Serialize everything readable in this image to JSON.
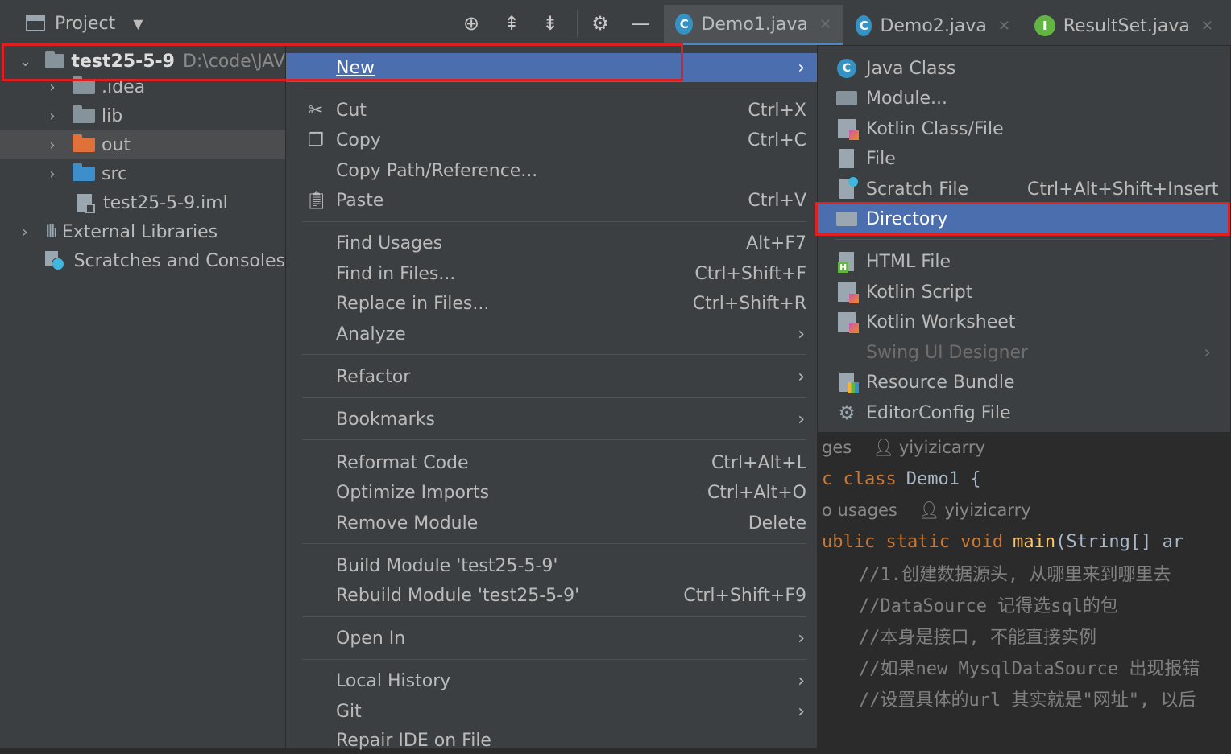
{
  "toolbar": {
    "project_label": "Project",
    "icons": [
      "crosshair-icon",
      "expand-all-icon",
      "collapse-all-icon",
      "gear-icon",
      "minimize-icon"
    ],
    "tabs": [
      {
        "label": "Demo1.java",
        "active": true,
        "icon": "C"
      },
      {
        "label": "Demo2.java",
        "active": false,
        "icon": "C"
      },
      {
        "label": "ResultSet.java",
        "active": false,
        "icon": "I"
      }
    ]
  },
  "tree": {
    "root_name": "test25-5-9",
    "root_path": "D:\\code\\JAV",
    "items": [
      {
        "label": ".idea"
      },
      {
        "label": "lib"
      },
      {
        "label": "out"
      },
      {
        "label": "src"
      },
      {
        "label": "test25-5-9.iml"
      },
      {
        "label": "External Libraries"
      },
      {
        "label": "Scratches and Consoles"
      }
    ]
  },
  "menu": {
    "items": [
      {
        "label": "New",
        "submenu": true
      },
      {
        "label": "Cut",
        "shortcut": "Ctrl+X"
      },
      {
        "label": "Copy",
        "shortcut": "Ctrl+C"
      },
      {
        "label": "Copy Path/Reference..."
      },
      {
        "label": "Paste",
        "shortcut": "Ctrl+V"
      },
      {
        "label": "Find Usages",
        "shortcut": "Alt+F7"
      },
      {
        "label": "Find in Files...",
        "shortcut": "Ctrl+Shift+F"
      },
      {
        "label": "Replace in Files...",
        "shortcut": "Ctrl+Shift+R"
      },
      {
        "label": "Analyze",
        "submenu": true
      },
      {
        "label": "Refactor",
        "submenu": true
      },
      {
        "label": "Bookmarks",
        "submenu": true
      },
      {
        "label": "Reformat Code",
        "shortcut": "Ctrl+Alt+L"
      },
      {
        "label": "Optimize Imports",
        "shortcut": "Ctrl+Alt+O"
      },
      {
        "label": "Remove Module",
        "shortcut": "Delete"
      },
      {
        "label": "Build Module 'test25-5-9'"
      },
      {
        "label": "Rebuild Module 'test25-5-9'",
        "shortcut": "Ctrl+Shift+F9"
      },
      {
        "label": "Open In",
        "submenu": true
      },
      {
        "label": "Local History",
        "submenu": true
      },
      {
        "label": "Git",
        "submenu": true
      },
      {
        "label": "Repair IDE on File"
      }
    ]
  },
  "submenu": {
    "items": [
      {
        "label": "Java Class"
      },
      {
        "label": "Module..."
      },
      {
        "label": "Kotlin Class/File"
      },
      {
        "label": "File"
      },
      {
        "label": "Scratch File",
        "shortcut": "Ctrl+Alt+Shift+Insert"
      },
      {
        "label": "Directory"
      },
      {
        "label": "HTML File"
      },
      {
        "label": "Kotlin Script"
      },
      {
        "label": "Kotlin Worksheet"
      },
      {
        "label": "Swing UI Designer"
      },
      {
        "label": "Resource Bundle"
      },
      {
        "label": "EditorConfig File"
      }
    ]
  },
  "editor": {
    "hint1_usages": "ges",
    "hint1_author": "yiyizicarry",
    "line_class_kw": "c class",
    "line_class_name": "Demo1 {",
    "hint2_usages": "o usages",
    "hint2_author": "yiyizicarry",
    "line_main_kw": "ublic static void",
    "line_main_fn": "main",
    "line_main_rest": "(String[] ar",
    "comments": [
      "//1.创建数据源头, 从哪里来到哪里去",
      "//DataSource 记得选sql的包",
      "//本身是接口, 不能直接实例",
      "//如果new MysqlDataSource 出现报错",
      "//设置具体的url  其实就是\"网址\", 以后"
    ]
  }
}
